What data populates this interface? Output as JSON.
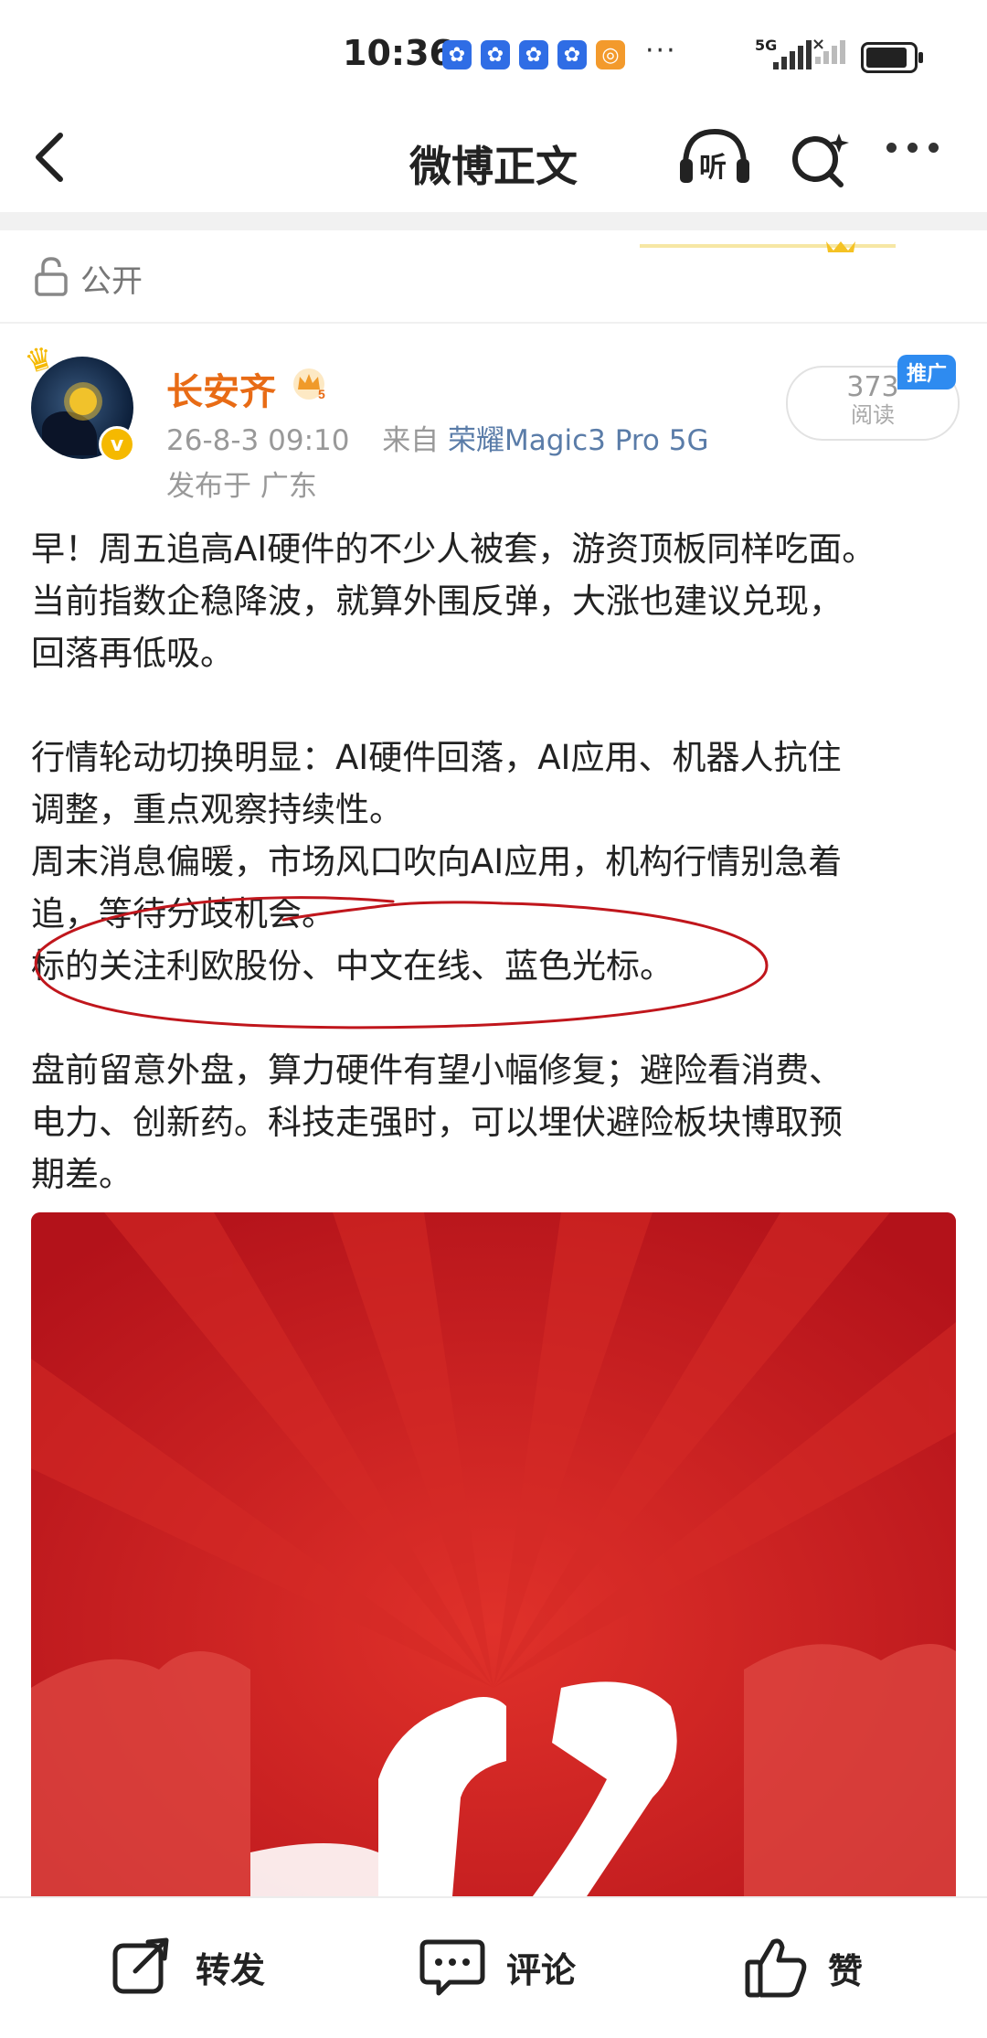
{
  "status_bar": {
    "time": "10:36",
    "notification_icons": [
      "app-notification-icon",
      "app-notification-icon",
      "app-notification-icon",
      "app-notification-icon",
      "qq-browser-icon"
    ],
    "more": "···",
    "network": "5G"
  },
  "nav": {
    "title": "微博正文",
    "listen_label": "听"
  },
  "visibility": {
    "label": "公开"
  },
  "post": {
    "author": "长安齐",
    "verified_badge": "v",
    "level": "5",
    "timestamp": "26-8-3 09:10",
    "from_label": "来自",
    "source": "荣耀Magic3 Pro 5G",
    "location": "发布于 广东",
    "read_count": "373",
    "read_label": "阅读",
    "promo_tag": "推广",
    "lines": [
      "早！周五追高AI硬件的不少人被套，游资顶板同样吃面。",
      "当前指数企稳降波，就算外围反弹，大涨也建议兑现，",
      "回落再低吸。",
      "",
      "行情轮动切换明显：AI硬件回落，AI应用、机器人抗住",
      "调整，重点观察持续性。",
      "周末消息偏暖，市场风口吹向AI应用，机构行情别急着",
      "追，等待分歧机会。",
      "标的关注利欧股份、中文在线、蓝色光标。",
      "",
      "盘前留意外盘，算力硬件有望小幅修复；避险看消费、",
      "电力、创新药。科技走强时，可以埋伏避险板块博取预",
      "期差。"
    ]
  },
  "actions": {
    "repost": "转发",
    "comment": "评论",
    "like": "赞"
  },
  "colors": {
    "author": "#e86b15",
    "source_link": "#5a7ca8",
    "promo": "#2e8bf0",
    "image_red": "#c8191c",
    "annotation_red": "#c0161c"
  }
}
